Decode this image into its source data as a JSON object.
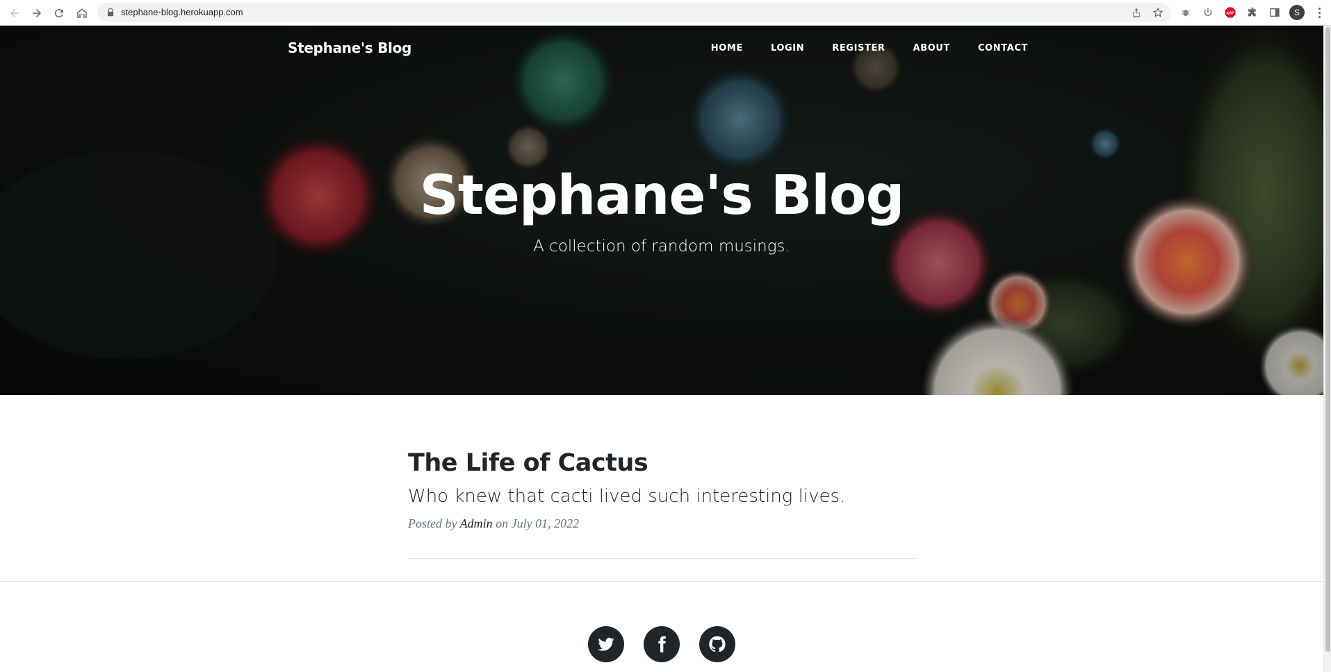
{
  "browser": {
    "url": "stephane-blog.herokuapp.com",
    "profile_initial": "S",
    "icons": [
      "back-icon",
      "forward-icon",
      "reload-icon",
      "home-icon",
      "lock-icon",
      "share-icon",
      "star-icon",
      "bug-extension-icon",
      "power-extension-icon",
      "adblock-extension-icon",
      "puzzle-extension-icon",
      "sidepanel-icon",
      "kebab-menu-icon"
    ],
    "adblock_label": "ABP"
  },
  "site": {
    "brand": "Stephane's Blog",
    "nav": [
      {
        "label": "HOME"
      },
      {
        "label": "LOGIN"
      },
      {
        "label": "REGISTER"
      },
      {
        "label": "ABOUT"
      },
      {
        "label": "CONTACT"
      }
    ]
  },
  "hero": {
    "title": "Stephane's Blog",
    "subtitle": "A collection of random musings."
  },
  "posts": [
    {
      "title": "The Life of Cactus",
      "subtitle": "Who knew that cacti lived such interesting lives.",
      "meta_prefix": "Posted by",
      "author": "Admin",
      "meta_on": "on",
      "date": "July 01, 2022"
    }
  ],
  "footer": {
    "socials": [
      "twitter-icon",
      "facebook-icon",
      "github-icon"
    ]
  },
  "colors": {
    "text_dark": "#212529",
    "muted": "#6c757d",
    "divider": "#dee2e6"
  }
}
